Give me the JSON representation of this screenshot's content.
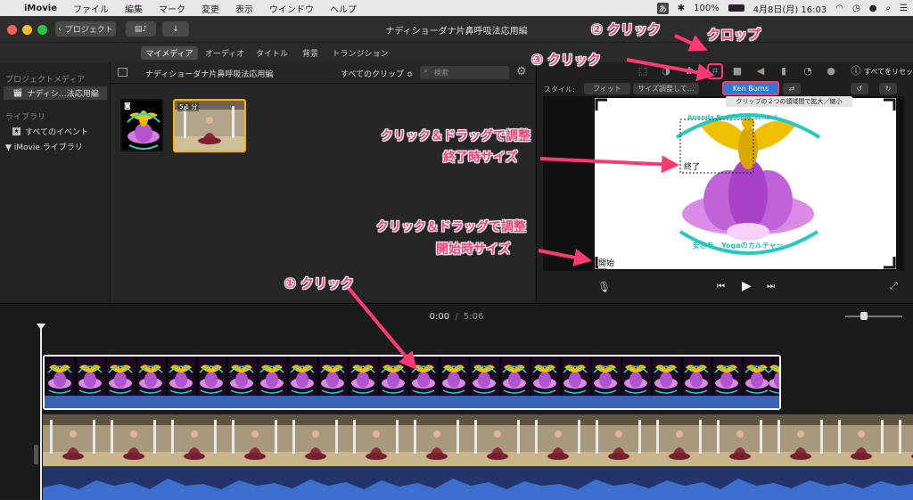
{
  "menubar": {
    "apple": "",
    "items": [
      "iMovie",
      "ファイル",
      "編集",
      "マーク",
      "変更",
      "表示",
      "ウインドウ",
      "ヘルプ"
    ],
    "ime": "あ",
    "battery": "100%",
    "clock": "4月8日(月) 16:03"
  },
  "titlebar": {
    "projects_button": "プロジェクト",
    "title": "ナディショーダナ片鼻呼吸法応用編"
  },
  "tabs": [
    "マイメディア",
    "オーディオ",
    "タイトル",
    "背景",
    "トランジション"
  ],
  "sidebar": {
    "project_media_header": "プロジェクトメディア",
    "project_item": "ナディシ…法応用編",
    "library_header": "ライブラリ",
    "all_events": "すべてのイベント",
    "imovie_library": "▼ iMovie ライブラリ"
  },
  "browser": {
    "title": "ナディショーダナ片鼻呼吸法応用編",
    "filter": "すべてのクリップ ≎",
    "search_placeholder": "検索",
    "clip2_duration": "5.1 分"
  },
  "viewer": {
    "reset_all": "すべてをリセット",
    "style_label": "スタイル:",
    "style_buttons": [
      "フィット",
      "サイズ調整して…",
      "Ken Burns"
    ],
    "tooltip": "クリップの２つの領域間で拡大／縮小",
    "end_label": "終了",
    "start_label": "開始",
    "arc_top_text": "Ananda Bodymind School",
    "arc_bottom_text": "安心を、Yogaのカルチャー"
  },
  "timeline": {
    "current": "0:00",
    "separator": "/",
    "total": "5:06"
  },
  "annotations": {
    "step1": "①  クリック",
    "step2": "②  クリック",
    "step3": "③  クリック",
    "crop": "クロップ",
    "end_line1": "クリック＆ドラッグで調整",
    "end_line2": "終了時サイズ",
    "start_line1": "クリック＆ドラッグで調整",
    "start_line2": "開始時サイズ"
  },
  "colors": {
    "annotation_pink": "#ff3a72",
    "ken_burns_blue": "#2a7bd8",
    "audio_wave": "#2f56a8",
    "clip_title_blue": "#3a63b5"
  }
}
